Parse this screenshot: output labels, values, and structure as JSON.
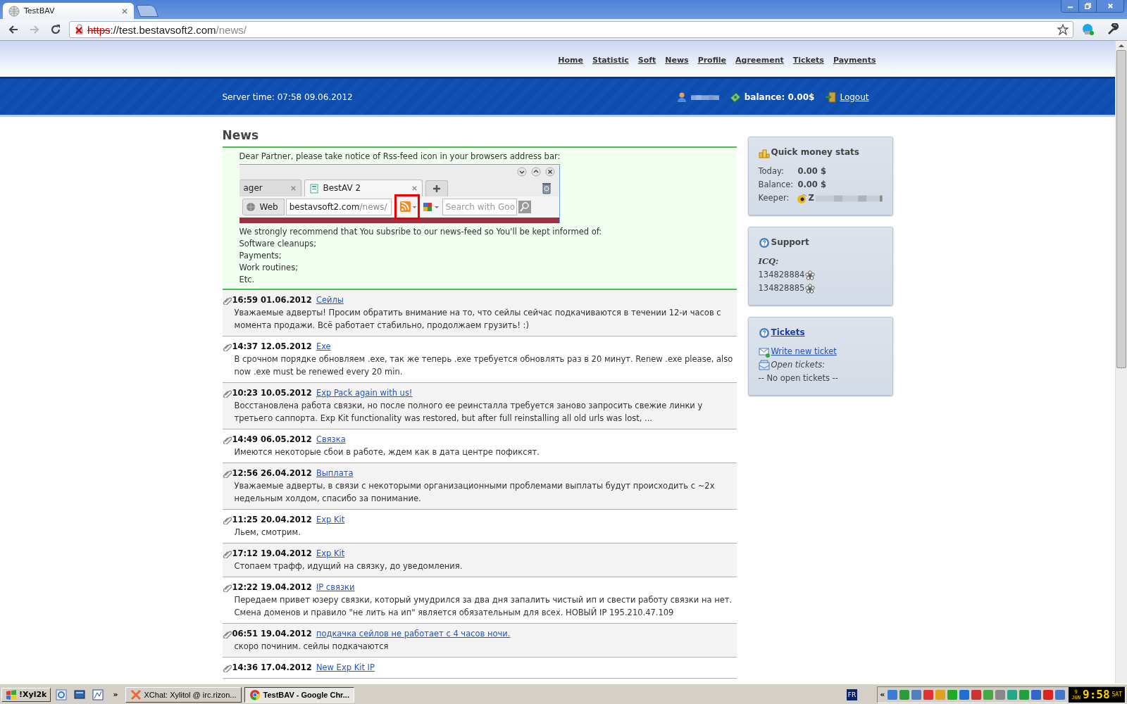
{
  "browser": {
    "tabs": [
      {
        "title": "TestBAV",
        "selected": true
      }
    ],
    "address": {
      "scheme": "https",
      "certificate_error": true,
      "host": "://test.bestavsoft2.com",
      "path": "/news/"
    }
  },
  "nav": [
    "Home",
    "Statistic",
    "Soft",
    "News",
    "Profile",
    "Agreement",
    "Tickets",
    "Payments"
  ],
  "infobar": {
    "server_time": "Server time: 07:58 09.06.2012",
    "balance": "balance: 0.00$",
    "logout": "Logout"
  },
  "page_title": "News",
  "notice": {
    "intro": "Dear Partner, please take notice of Rss-feed icon in your browsers address bar:",
    "screenshot": {
      "tabs": [
        {
          "title": "ager",
          "selected": false
        },
        {
          "title": "BestAV 2",
          "selected": true
        }
      ],
      "location_label": "Web",
      "url_host": "bestavsoft2.com",
      "url_path": "/news/",
      "search_placeholder": "Search with Goo"
    },
    "lines": [
      "We strongly recommend that You subsribe to our news-feed so You'll be kept informed of:",
      "Software cleanups;",
      "Payments;",
      "Work routines;",
      "Etc."
    ]
  },
  "news": [
    {
      "time": "16:59 01.06.2012",
      "title": "Сейлы",
      "body": "Уважаемые адверты! Просим обратить внимание на то, что сейлы сейчас подкачиваются в течении 12-и часов с момента продажи. Всё работает стабильно, продолжаем грузить! :)"
    },
    {
      "time": "14:37 12.05.2012",
      "title": "Exe",
      "body": "В срочном порядке обновляем .exe, так же теперь .exe требуется обновлять раз в 20 минут. Renew .exe please, also now .exe must be renewed every 20 min."
    },
    {
      "time": "10:23 10.05.2012",
      "title": "Exp Pack again with us!",
      "body": "Восстановлена работа связки, но после полного ее реинсталла требуется заново запросить свежие линки у третьего саппорта. Exp Kit functionality was restored, but after full reinstalling all old urls was lost, ..."
    },
    {
      "time": "14:49 06.05.2012",
      "title": "Связка",
      "body": "Имеются некоторые сбои в работе, ждем как в дата центре пофиксят."
    },
    {
      "time": "12:56 26.04.2012",
      "title": "Выплата",
      "body": "Уважаемые адверты, в связи с некоторыми организационными проблемами выплаты будут происходить с ~2х недельным холдом, спасибо за понимание."
    },
    {
      "time": "11:25 20.04.2012",
      "title": "Exp Kit",
      "body": "Льем, смотрим."
    },
    {
      "time": "17:12 19.04.2012",
      "title": "Exp Kit",
      "body": "Стопаем трафф, идущий на связку, до уведомления."
    },
    {
      "time": "12:22 19.04.2012",
      "title": "IP связки",
      "body": "Передаем привет юзеру связки, который умудрился за два дня запалить чистый ип и свести работу связки на нет. Смена доменов и правило \"не лить на ип\" является обязательным для всех. НОВЫЙ IP 195.210.47.109"
    },
    {
      "time": "06:51 19.04.2012",
      "title": "подкачка сейлов не работает с 4 часов ночи.",
      "body": "скоро починим. сейлы подкачаются"
    },
    {
      "time": "14:36 17.04.2012",
      "title": "New Exp Kit IP"
    }
  ],
  "sidebar": {
    "money": {
      "title": "Quick money stats",
      "rows": [
        {
          "label": "Today:",
          "value": "0.00 $"
        },
        {
          "label": "Balance:",
          "value": "0.00 $"
        },
        {
          "label": "Keeper:",
          "value": "Z"
        }
      ]
    },
    "support": {
      "title": "Support",
      "icq_label": "ICQ:",
      "numbers": [
        "134828884",
        "134828885"
      ]
    },
    "tickets": {
      "title": "Tickets",
      "write_link": "Write new ticket",
      "open_label": "Open tickets:",
      "empty": "-- No open tickets --"
    }
  },
  "taskbar": {
    "start": "!Xyl2k",
    "overflow": "»",
    "tasks": [
      {
        "title": "XChat: Xylitol @ irc.rizon...",
        "selected": false
      },
      {
        "title": "TestBAV - Google Chr...",
        "selected": true
      }
    ],
    "language": "FR",
    "tray_overflow": "«",
    "clock": {
      "day": "9",
      "month": "JUN",
      "time": "9:58",
      "weekday": "SAT"
    }
  }
}
